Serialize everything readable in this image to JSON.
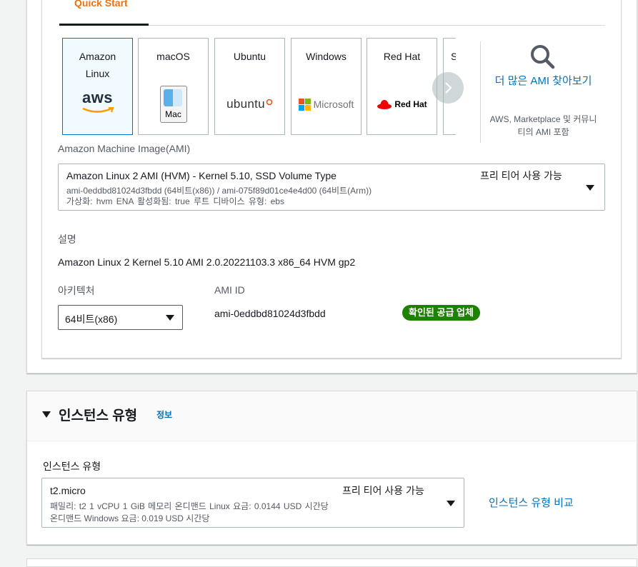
{
  "ami_section": {
    "tab_label": "Quick Start",
    "os_tiles": [
      {
        "label": "Amazon Linux",
        "logo_text": "aws",
        "selected": true
      },
      {
        "label": "macOS",
        "logo_text": "Mac",
        "selected": false
      },
      {
        "label": "Ubuntu",
        "logo_text": "ubuntu",
        "selected": false
      },
      {
        "label": "Windows",
        "logo_text": "Microsoft",
        "selected": false
      },
      {
        "label": "Red Hat",
        "logo_text": "Red Hat",
        "selected": false
      },
      {
        "label": "S",
        "logo_text": "",
        "selected": false
      }
    ],
    "browse_more": {
      "link": "더 많은 AMI 찾아보기",
      "sub": "AWS, Marketplace 및 커뮤니티의 AMI 포함"
    },
    "ami_label": "Amazon Machine Image(AMI)",
    "ami_select": {
      "title": "Amazon Linux 2 AMI (HVM) - Kernel 5.10, SSD Volume Type",
      "free_tier": "프리 티어 사용 가능",
      "line2": "ami-0eddbd81024d3fbdd (64비트(x86)) / ami-075f89d01ce4e4d00 (64비트(Arm))",
      "line3": "가상화: hvm    ENA 활성화됨: true    루트 디바이스 유형: ebs"
    },
    "description_label": "설명",
    "description": "Amazon Linux 2 Kernel 5.10 AMI 2.0.20221103.3 x86_64 HVM gp2",
    "architecture_label": "아키텍처",
    "architecture_value": "64비트(x86)",
    "ami_id_label": "AMI ID",
    "ami_id_value": "ami-0eddbd81024d3fbdd",
    "verified_badge": "확인된 공급 업체"
  },
  "instance_section": {
    "title": "인스턴스 유형",
    "info_link": "정보",
    "field_label": "인스턴스 유형",
    "select": {
      "title": "t2.micro",
      "free_tier": "프리 티어 사용 가능",
      "line2": "패밀리: t2    1 vCPU    1 GiB 메모리        온디맨드 Linux 요금: 0.0144 USD 시간당",
      "line3": "온디맨드 Windows 요금: 0.019 USD 시간당"
    },
    "compare_link": "인스턴스 유형 비교"
  },
  "colors": {
    "accent_orange": "#ec7211",
    "link_blue": "#0073bb",
    "badge_green": "#1d8102"
  }
}
